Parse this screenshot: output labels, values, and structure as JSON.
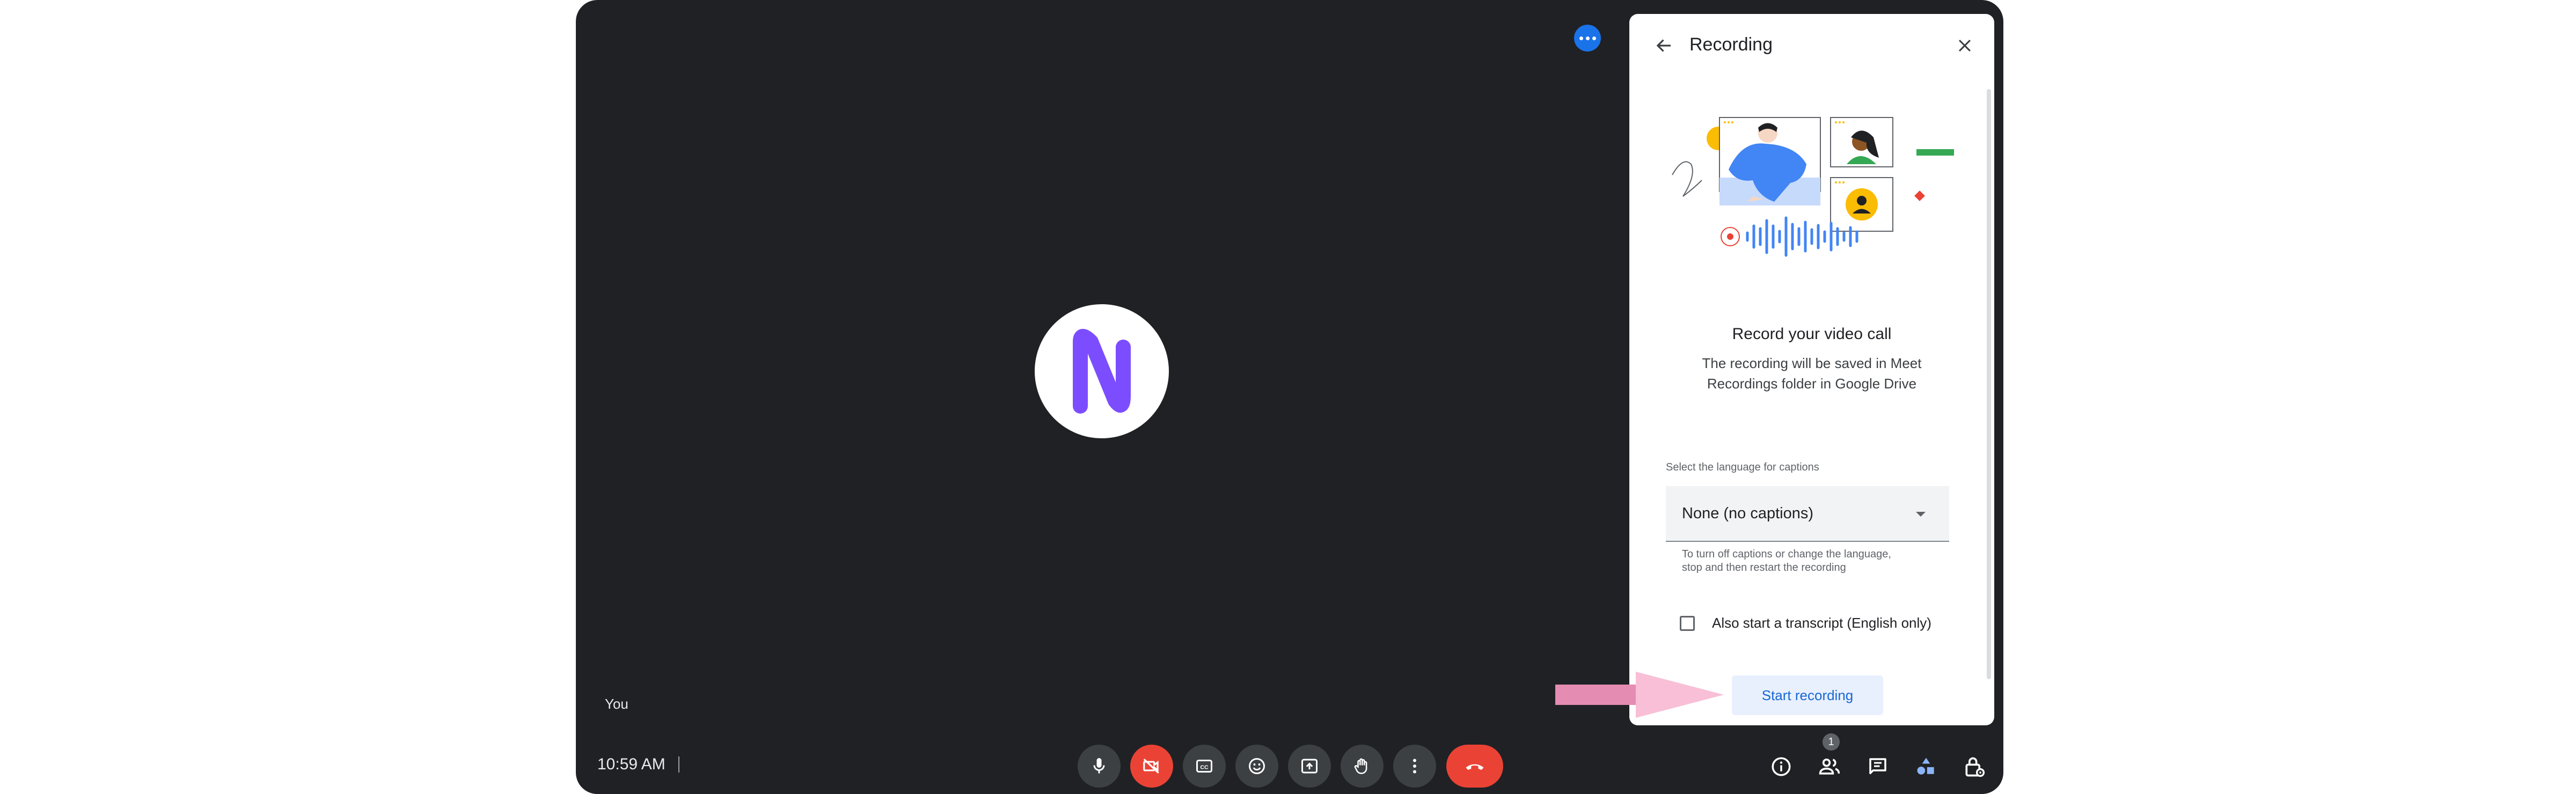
{
  "meeting": {
    "self_label": "You",
    "time": "10:59 AM",
    "participants_count": "1"
  },
  "recording_panel": {
    "title": "Recording",
    "heading": "Record your video call",
    "description": "The recording will be saved in Meet Recordings folder in Google Drive",
    "language_label": "Select the language for captions",
    "language_value": "None (no captions)",
    "language_help": "To turn off captions or change the language, stop and then restart the recording",
    "transcript_label": "Also start a transcript (English only)",
    "transcript_checked": false,
    "start_button": "Start recording"
  },
  "icons": {
    "avatar_letter": "N",
    "controls": [
      "microphone-icon",
      "camera-off-icon",
      "captions-icon",
      "emoji-icon",
      "present-icon",
      "raise-hand-icon",
      "more-options-icon",
      "end-call-icon"
    ],
    "right_controls": [
      "info-icon",
      "people-icon",
      "chat-icon",
      "activities-icon",
      "host-controls-icon"
    ]
  },
  "colors": {
    "background": "#202124",
    "control": "#3c4043",
    "danger": "#ea4335",
    "accent": "#1a73e8",
    "avatar_glyph": "#7c4dff",
    "hint_arrow": "#f4a7c6"
  }
}
